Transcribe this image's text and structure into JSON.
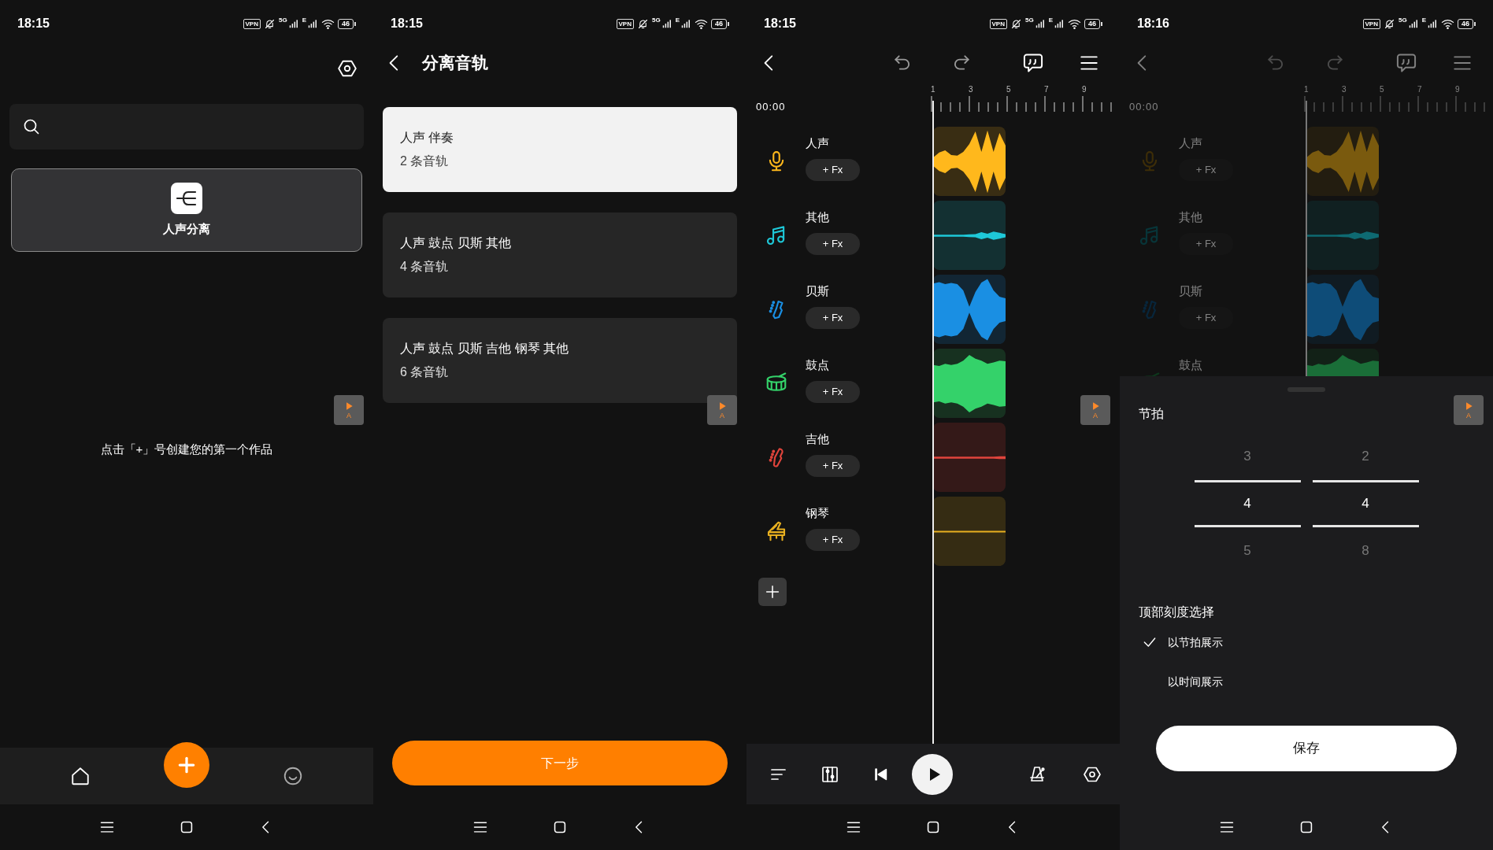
{
  "screens": [
    {
      "kind": "home",
      "status_bar": {
        "time": "18:15",
        "vpn": "VPN",
        "network_1": "5G",
        "network_2": "E",
        "battery": "46"
      },
      "tool_card": {
        "label": "人声分离"
      },
      "empty_message": "点击「+」号创建您的第一个作品",
      "floating_widget": {
        "label": "A"
      }
    },
    {
      "kind": "separate",
      "status_bar": {
        "time": "18:15",
        "vpn": "VPN",
        "network_1": "5G",
        "network_2": "E",
        "battery": "46"
      },
      "title": "分离音轨",
      "options": [
        {
          "title": "人声 伴奏",
          "subtitle": "2 条音轨",
          "selected": true
        },
        {
          "title": "人声 鼓点 贝斯 其他",
          "subtitle": "4 条音轨",
          "selected": false
        },
        {
          "title": "人声 鼓点 贝斯 吉他 钢琴 其他",
          "subtitle": "6 条音轨",
          "selected": false
        }
      ],
      "floating_widget": {
        "label": "A"
      },
      "next_button": "下一步"
    },
    {
      "kind": "editor",
      "status_bar": {
        "time": "18:15",
        "vpn": "VPN",
        "network_1": "5G",
        "network_2": "E",
        "battery": "46"
      },
      "time": "00:00",
      "ruler_labels": [
        "1",
        "3",
        "5",
        "7",
        "9"
      ],
      "tracks": [
        {
          "kind": "vocal",
          "name": "人声",
          "fx": "+ Fx",
          "color": "#ffb81c"
        },
        {
          "kind": "other",
          "name": "其他",
          "fx": "+ Fx",
          "color": "#1ec8d8"
        },
        {
          "kind": "bass",
          "name": "贝斯",
          "fx": "+ Fx",
          "color": "#1a8fe3"
        },
        {
          "kind": "drums",
          "name": "鼓点",
          "fx": "+ Fx",
          "color": "#34d26a"
        },
        {
          "kind": "guitar",
          "name": "吉他",
          "fx": "+ Fx",
          "color": "#e0443c"
        },
        {
          "kind": "piano",
          "name": "钢琴",
          "fx": "+ Fx",
          "color": "#e8b020"
        }
      ],
      "floating_widget": {
        "label": "A"
      }
    },
    {
      "kind": "editor_sheet",
      "status_bar": {
        "time": "18:16",
        "vpn": "VPN",
        "network_1": "5G",
        "network_2": "E",
        "battery": "46"
      },
      "time": "00:00",
      "ruler_labels": [
        "1",
        "3",
        "5",
        "7",
        "9"
      ],
      "tracks": [
        {
          "kind": "vocal",
          "name": "人声",
          "fx": "+ Fx",
          "color": "#7a5a0e"
        },
        {
          "kind": "other",
          "name": "其他",
          "fx": "+ Fx",
          "color": "#0e6a72"
        },
        {
          "kind": "bass",
          "name": "贝斯",
          "fx": "+ Fx",
          "color": "#0e4c78"
        },
        {
          "kind": "drums",
          "name": "鼓点",
          "color": "#1a6e38"
        }
      ],
      "sheet": {
        "title": "节拍",
        "picker": [
          {
            "items": [
              {
                "value": "3",
                "selected": false
              },
              {
                "value": "4",
                "selected": true
              },
              {
                "value": "5",
                "selected": false
              }
            ]
          },
          {
            "items": [
              {
                "value": "2",
                "selected": false
              },
              {
                "value": "4",
                "selected": true
              },
              {
                "value": "8",
                "selected": false
              }
            ]
          }
        ],
        "section_title": "顶部刻度选择",
        "options": [
          {
            "label": "以节拍展示",
            "selected": true
          },
          {
            "label": "以时间展示",
            "selected": false
          }
        ],
        "save_button": "保存"
      },
      "floating_widget": {
        "label": "A"
      }
    }
  ]
}
